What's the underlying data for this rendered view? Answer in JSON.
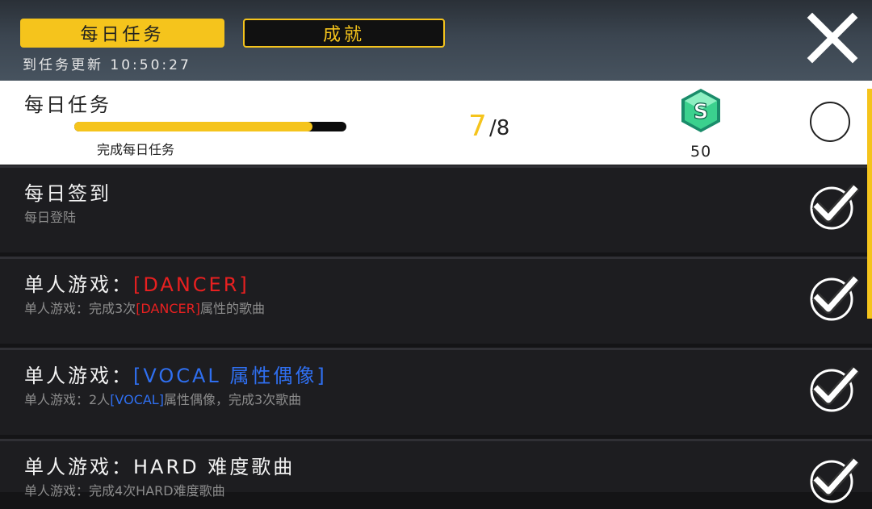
{
  "tabs": {
    "daily": "每日任务",
    "achievement": "成就"
  },
  "timer": "到任务更新 10:50:27",
  "task_panel": {
    "title": "每日任务",
    "bar_label": "完成每日任务",
    "progress_current": "7",
    "progress_total": "/8",
    "progress_fraction": 0.875,
    "reward_icon": "s-gem-icon",
    "reward_value": "50"
  },
  "rows": [
    {
      "title": "每日签到",
      "desc": "每日登陆",
      "status": "completed"
    },
    {
      "title_prefix": "单人游戏：",
      "title_highlight": "[DANCER]",
      "desc_prefix": "单人游戏：完成3次",
      "desc_highlight": "[DANCER]",
      "desc_suffix": "属性的歌曲",
      "status": "completed"
    },
    {
      "title_prefix": "单人游戏：",
      "title_highlight": "[VOCAL 属性偶像]",
      "desc_prefix": "单人游戏：2人",
      "desc_highlight": "[VOCAL]",
      "desc_suffix": "属性偶像，完成3次歌曲",
      "status": "completed"
    },
    {
      "title": "单人游戏：HARD 难度歌曲",
      "desc": "单人游戏：完成4次HARD难度歌曲",
      "status": "completed"
    }
  ],
  "colors": {
    "accent": "#f5c41c",
    "dancer": "#e82020",
    "vocal": "#2f6ff0"
  }
}
